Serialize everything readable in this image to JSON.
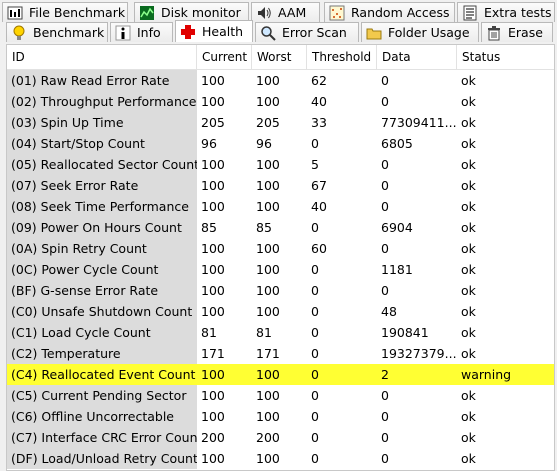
{
  "tabs_top": [
    {
      "label": "File Benchmark",
      "icon": "file-benchmark-icon"
    },
    {
      "label": "Disk monitor",
      "icon": "disk-monitor-icon"
    },
    {
      "label": "AAM",
      "icon": "aam-speaker-icon"
    },
    {
      "label": "Random Access",
      "icon": "random-access-icon"
    },
    {
      "label": "Extra tests",
      "icon": "extra-tests-icon"
    }
  ],
  "tabs_bottom": [
    {
      "label": "Benchmark",
      "icon": "benchmark-bulb-icon"
    },
    {
      "label": "Info",
      "icon": "info-icon"
    },
    {
      "label": "Health",
      "icon": "health-cross-icon",
      "active": true
    },
    {
      "label": "Error Scan",
      "icon": "error-scan-icon"
    },
    {
      "label": "Folder Usage",
      "icon": "folder-usage-icon"
    },
    {
      "label": "Erase",
      "icon": "erase-trash-icon"
    }
  ],
  "table": {
    "headers": [
      "ID",
      "Current",
      "Worst",
      "Threshold",
      "Data",
      "Status"
    ],
    "rows": [
      [
        "(01) Raw Read Error Rate",
        "100",
        "100",
        "62",
        "0",
        "ok"
      ],
      [
        "(02) Throughput Performance",
        "100",
        "100",
        "40",
        "0",
        "ok"
      ],
      [
        "(03) Spin Up Time",
        "205",
        "205",
        "33",
        "77309411...",
        "ok"
      ],
      [
        "(04) Start/Stop Count",
        "96",
        "96",
        "0",
        "6805",
        "ok"
      ],
      [
        "(05) Reallocated Sector Count",
        "100",
        "100",
        "5",
        "0",
        "ok"
      ],
      [
        "(07) Seek Error Rate",
        "100",
        "100",
        "67",
        "0",
        "ok"
      ],
      [
        "(08) Seek Time Performance",
        "100",
        "100",
        "40",
        "0",
        "ok"
      ],
      [
        "(09) Power On Hours Count",
        "85",
        "85",
        "0",
        "6904",
        "ok"
      ],
      [
        "(0A) Spin Retry Count",
        "100",
        "100",
        "60",
        "0",
        "ok"
      ],
      [
        "(0C) Power Cycle Count",
        "100",
        "100",
        "0",
        "1181",
        "ok"
      ],
      [
        "(BF) G-sense Error Rate",
        "100",
        "100",
        "0",
        "0",
        "ok"
      ],
      [
        "(C0) Unsafe Shutdown Count",
        "100",
        "100",
        "0",
        "48",
        "ok"
      ],
      [
        "(C1) Load Cycle Count",
        "81",
        "81",
        "0",
        "190841",
        "ok"
      ],
      [
        "(C2) Temperature",
        "171",
        "171",
        "0",
        "19327379...",
        "ok"
      ],
      [
        "(C4) Reallocated Event Count",
        "100",
        "100",
        "0",
        "2",
        "warning"
      ],
      [
        "(C5) Current Pending Sector",
        "100",
        "100",
        "0",
        "0",
        "ok"
      ],
      [
        "(C6) Offline Uncorrectable",
        "100",
        "100",
        "0",
        "0",
        "ok"
      ],
      [
        "(C7) Interface CRC Error Count",
        "200",
        "200",
        "0",
        "0",
        "ok"
      ],
      [
        "(DF) Load/Unload Retry Count",
        "100",
        "100",
        "0",
        "0",
        "ok"
      ]
    ],
    "highlight_color": "#ffff33"
  }
}
